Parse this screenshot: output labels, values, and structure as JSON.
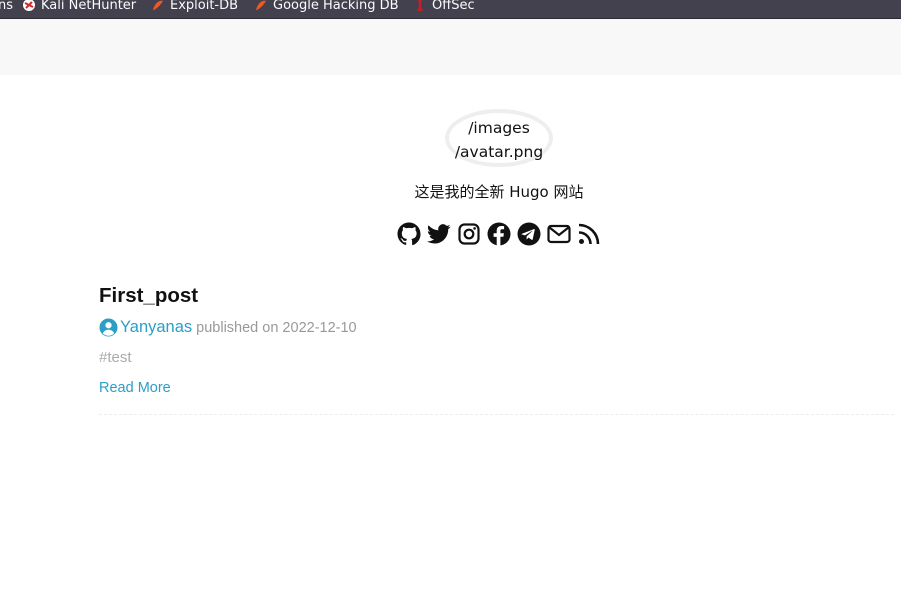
{
  "browser": {
    "bookmarks": [
      {
        "label": "ns",
        "icon": "none"
      },
      {
        "label": "Kali NetHunter",
        "icon": "kali-nethunter-icon"
      },
      {
        "label": "Exploit-DB",
        "icon": "exploit-db-icon"
      },
      {
        "label": "Google Hacking DB",
        "icon": "ghdb-icon"
      },
      {
        "label": "OffSec",
        "icon": "offsec-icon"
      }
    ]
  },
  "header": {
    "avatar_alt_line1": "/images",
    "avatar_alt_line2": "/avatar.png",
    "description": "这是我的全新 Hugo 网站",
    "social": [
      "github-icon",
      "twitter-icon",
      "instagram-icon",
      "facebook-icon",
      "telegram-icon",
      "email-icon",
      "rss-icon"
    ]
  },
  "post": {
    "title": "First_post",
    "author": "Yanyanas",
    "published": "published on 2022-12-10",
    "tag": "#test",
    "read_more": "Read More"
  },
  "colors": {
    "link": "#2b9fc6",
    "muted": "#999999",
    "bookmarks_bg": "#42414d",
    "header_bg": "#f8f8f8"
  }
}
